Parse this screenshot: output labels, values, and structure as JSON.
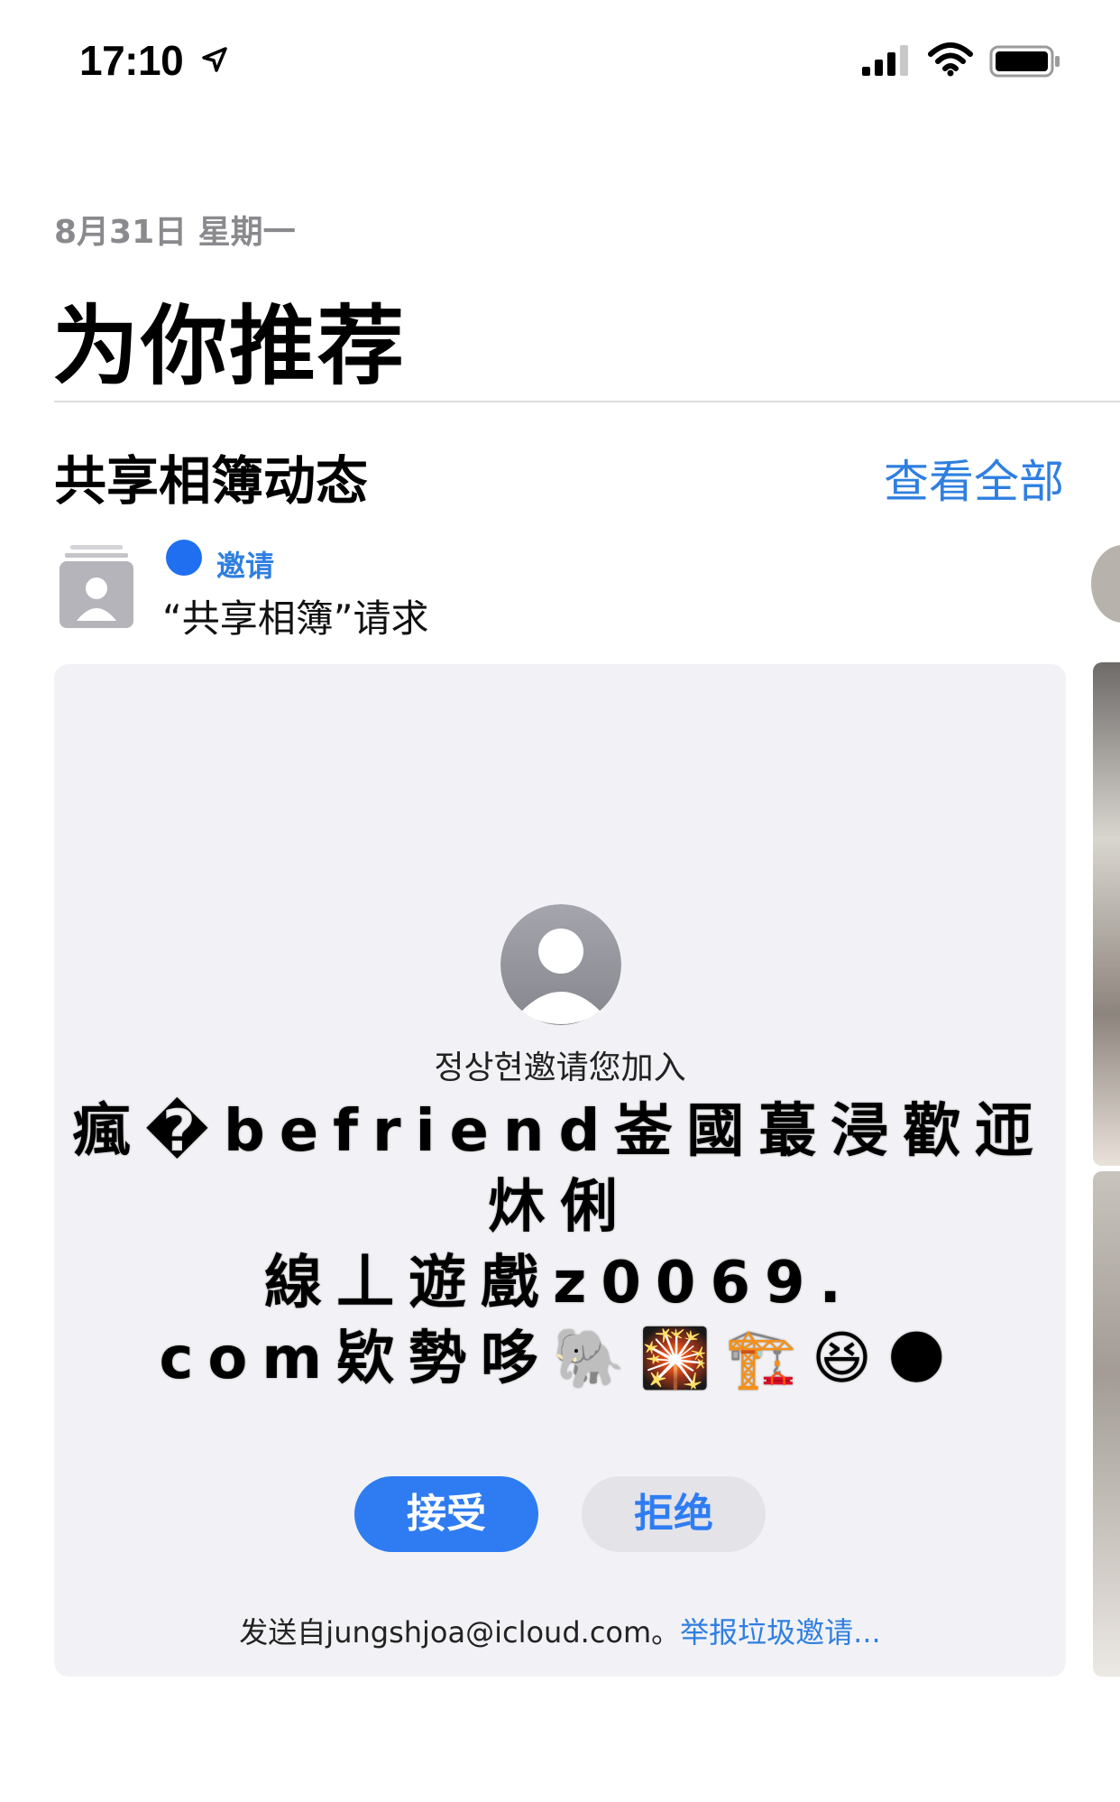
{
  "status_bar": {
    "time": "17:10",
    "icons": [
      "location-arrow-icon",
      "cellular-signal-icon",
      "wifi-icon",
      "battery-icon"
    ]
  },
  "header": {
    "date": "8月31日 星期一",
    "title": "为你推荐"
  },
  "section": {
    "title": "共享相簿动态",
    "see_all_label": "查看全部"
  },
  "invite": {
    "badge_label": "邀请",
    "request_text": "“共享相簿”请求",
    "icon": "shared-album-icon"
  },
  "card": {
    "inviter_text": "정상현邀请您加入",
    "album_name_line1": "瘋�befriend崟國蕞浸歡迊炑俐",
    "album_name_line2": "線丄遊戲z0069.",
    "album_name_line3": "com欵勢哆🐘🎇🏗️😆🌑",
    "accept_label": "接受",
    "decline_label": "拒绝",
    "sender_text": "发送自jungshjoa@icloud.com。",
    "report_label": "举报垃圾邀请..."
  },
  "colors": {
    "accent": "#2f7fe0",
    "dot": "#1f6ff0",
    "card_bg": "#f2f2f6",
    "decline_bg": "#e3e3e8"
  }
}
